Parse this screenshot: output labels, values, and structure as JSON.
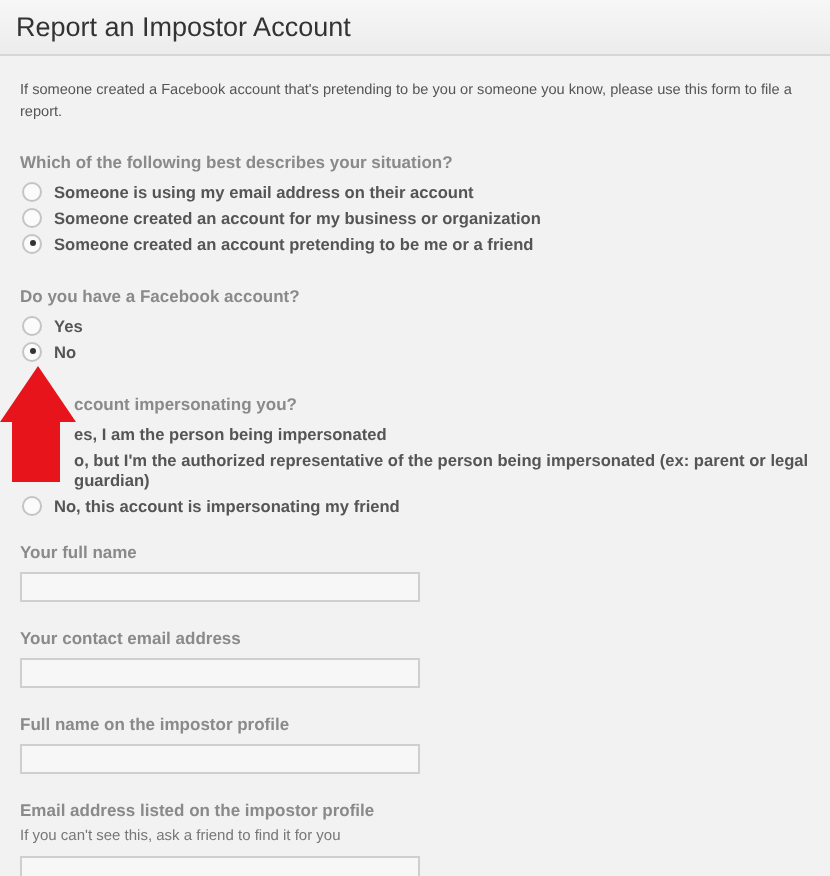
{
  "header": {
    "title": "Report an Impostor Account"
  },
  "intro": "If someone created a Facebook account that's pretending to be you or someone you know, please use this form to file a report.",
  "questions": [
    {
      "label": "Which of the following best describes your situation?",
      "options": [
        {
          "kind": "radio",
          "label": "Someone is using my email address on their account",
          "selected": false
        },
        {
          "kind": "radio",
          "label": "Someone created an account for my business or organization",
          "selected": false
        },
        {
          "kind": "radio",
          "label": "Someone created an account pretending to be me or a friend",
          "selected": true
        }
      ]
    },
    {
      "label": "Do you have a Facebook account?",
      "options": [
        {
          "kind": "radio",
          "label": "Yes",
          "selected": false
        },
        {
          "kind": "radio",
          "label": "No",
          "selected": true
        }
      ]
    },
    {
      "label": "ccount impersonating you?",
      "options": [
        {
          "kind": "covered",
          "label": "es, I am the person being impersonated"
        },
        {
          "kind": "covered",
          "label": "o, but I'm the authorized representative of the person being impersonated (ex: parent or legal guardian)"
        },
        {
          "kind": "radio",
          "label": "No, this account is impersonating my friend",
          "selected": false
        }
      ]
    }
  ],
  "fields": [
    {
      "label": "Your full name"
    },
    {
      "label": "Your contact email address"
    },
    {
      "label": "Full name on the impostor profile"
    },
    {
      "label": "Email address listed on the impostor profile",
      "hint": "If you can't see this, ask a friend to find it for you"
    }
  ]
}
